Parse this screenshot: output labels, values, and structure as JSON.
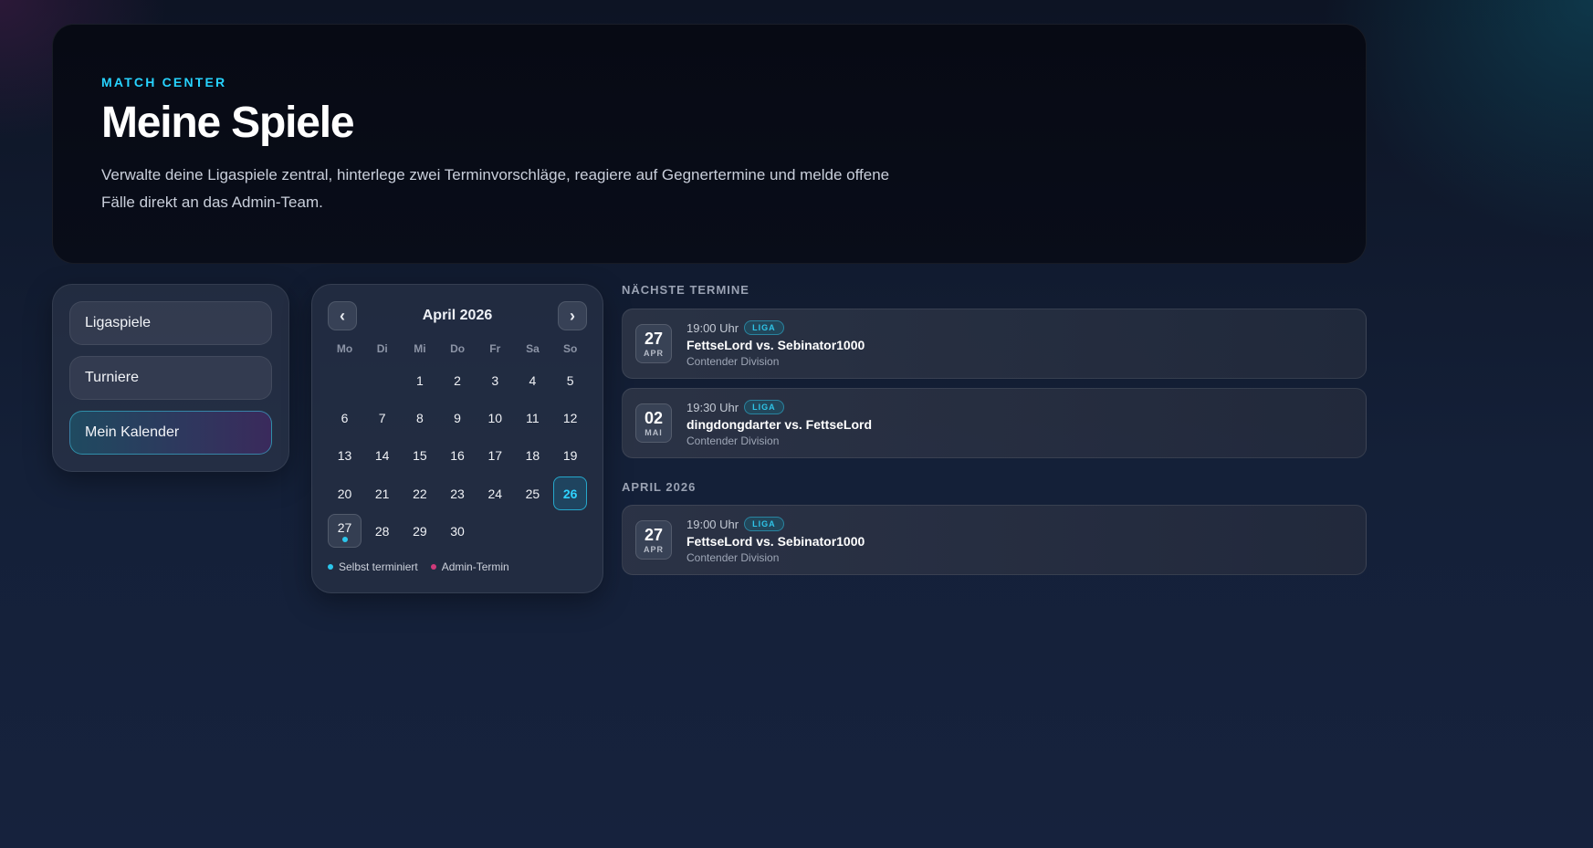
{
  "hero": {
    "eyebrow": "MATCH CENTER",
    "title": "Meine Spiele",
    "description": "Verwalte deine Ligaspiele zentral, hinterlege zwei Terminvorschläge, reagiere auf Gegnertermine und melde offene Fälle direkt an das Admin-Team."
  },
  "nav": {
    "items": [
      {
        "label": "Ligaspiele",
        "active": false
      },
      {
        "label": "Turniere",
        "active": false
      },
      {
        "label": "Mein Kalender",
        "active": true
      }
    ]
  },
  "calendar": {
    "month_label": "April 2026",
    "prev_icon": "‹",
    "next_icon": "›",
    "weekdays": [
      "Mo",
      "Di",
      "Mi",
      "Do",
      "Fr",
      "Sa",
      "So"
    ],
    "leading_blanks": 2,
    "days": [
      "1",
      "2",
      "3",
      "4",
      "5",
      "6",
      "7",
      "8",
      "9",
      "10",
      "11",
      "12",
      "13",
      "14",
      "15",
      "16",
      "17",
      "18",
      "19",
      "20",
      "21",
      "22",
      "23",
      "24",
      "25",
      "26",
      "27",
      "28",
      "29",
      "30"
    ],
    "today": "26",
    "event_days": [
      "27"
    ],
    "legend": [
      {
        "label": "Selbst terminiert",
        "color": "#2bc6ec"
      },
      {
        "label": "Admin-Termin",
        "color": "#d03a7a"
      }
    ]
  },
  "upcoming": {
    "label": "NÄCHSTE TERMINE",
    "events": [
      {
        "day": "27",
        "month": "APR",
        "time": "19:00 Uhr",
        "badge": "LIGA",
        "title": "FettseLord vs. Sebinator1000",
        "subtitle": "Contender Division"
      },
      {
        "day": "02",
        "month": "MAI",
        "time": "19:30 Uhr",
        "badge": "LIGA",
        "title": "dingdongdarter vs. FettseLord",
        "subtitle": "Contender Division"
      }
    ]
  },
  "month_section": {
    "label": "APRIL 2026",
    "events": [
      {
        "day": "27",
        "month": "APR",
        "time": "19:00 Uhr",
        "badge": "LIGA",
        "title": "FettseLord vs. Sebinator1000",
        "subtitle": "Contender Division"
      }
    ]
  },
  "colors": {
    "accent": "#27d3ff",
    "admin": "#d03a7a"
  }
}
